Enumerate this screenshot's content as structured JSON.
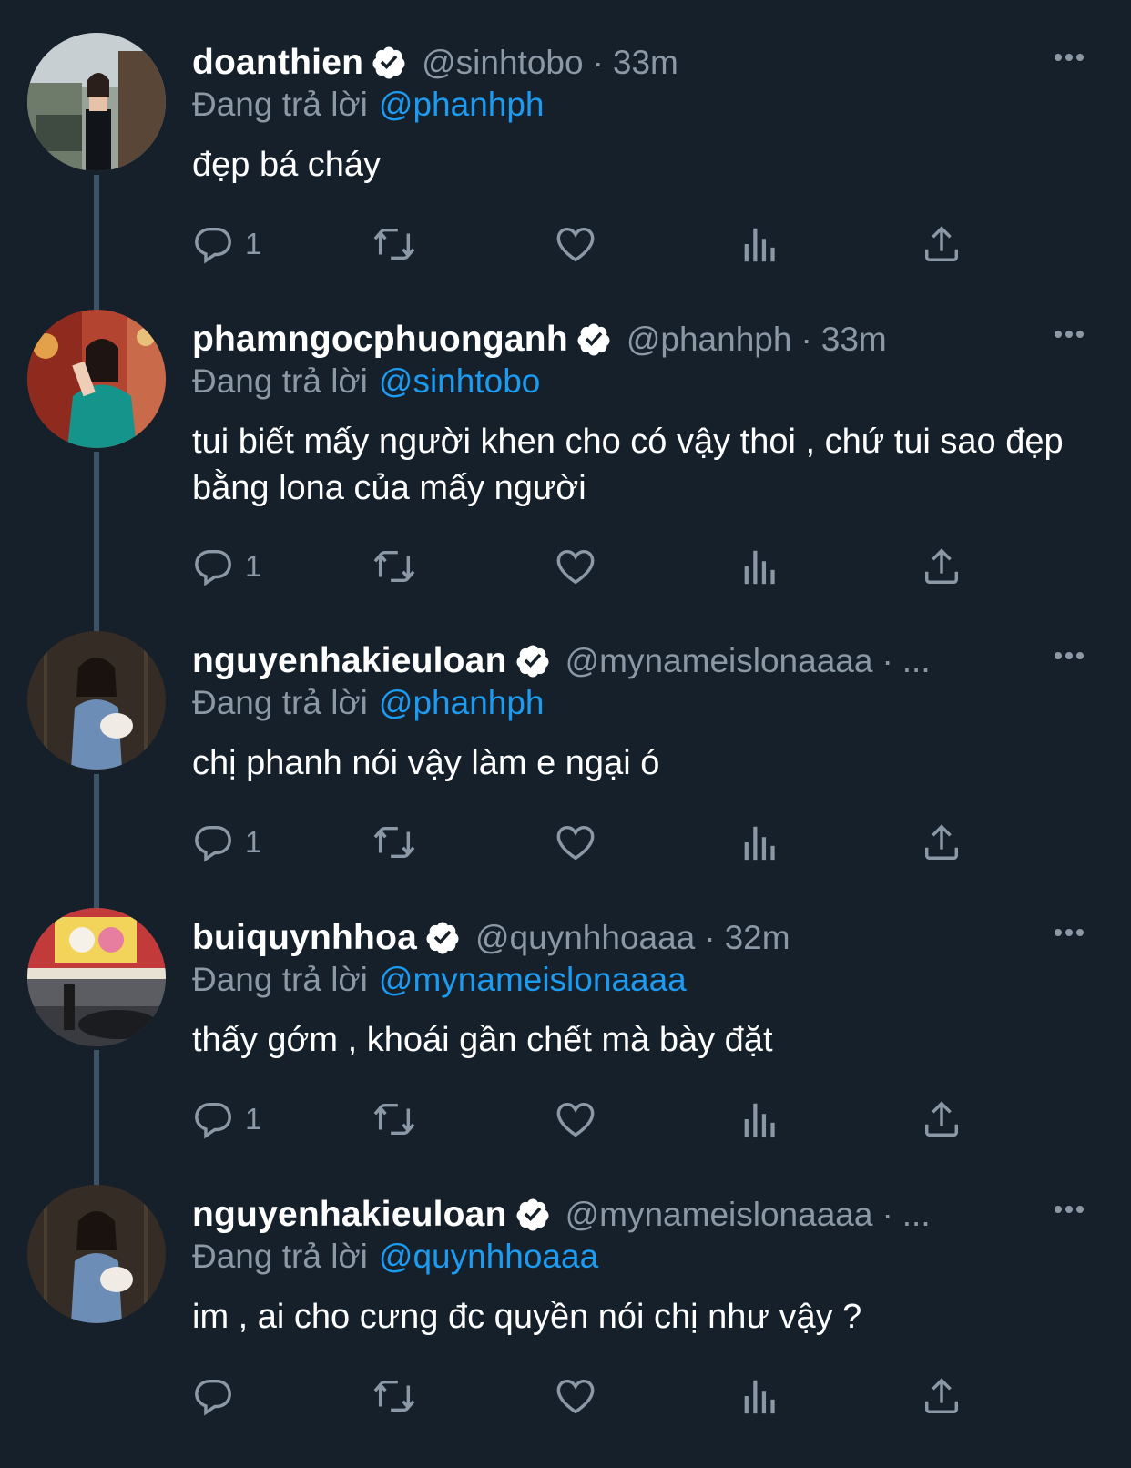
{
  "reply_prefix": "Đang trả lời",
  "colors": {
    "background": "#15202b",
    "secondary_text": "#8b98a5",
    "mention": "#1d9bf0",
    "verified": "#ffffff"
  },
  "tweets": [
    {
      "display_name": "doanthien",
      "verified": true,
      "handle": "@sinhtobo",
      "separator": "·",
      "time": "33m",
      "replying_to": "@phanhph",
      "text": "đẹp bá cháy",
      "reply_count": "1"
    },
    {
      "display_name": "phamngocphuonganh",
      "verified": true,
      "handle": "@phanhph",
      "separator": "·",
      "time": "33m",
      "replying_to": "@sinhtobo",
      "text": "tui biết mấy người khen cho có vậy thoi , chứ tui sao đẹp bằng lona của mấy người",
      "reply_count": "1"
    },
    {
      "display_name": "nguyenhakieuloan",
      "verified": true,
      "handle": "@mynameislonaaaa",
      "separator": "·",
      "time": "...",
      "replying_to": "@phanhph",
      "text": "chị phanh nói vậy làm e ngại ó",
      "reply_count": "1"
    },
    {
      "display_name": "buiquynhhoa",
      "verified": true,
      "handle": "@quynhhoaaa",
      "separator": "·",
      "time": "32m",
      "replying_to": "@mynameislonaaaa",
      "text": "thấy gớm , khoái gần chết mà bày đặt",
      "reply_count": "1"
    },
    {
      "display_name": "nguyenhakieuloan",
      "verified": true,
      "handle": "@mynameislonaaaa",
      "separator": "·",
      "time": "...",
      "replying_to": "@quynhhoaaa",
      "text": "im , ai cho cưng đc quyền nói chị như vậy ?",
      "reply_count": ""
    }
  ],
  "icons": {
    "reply": "reply-icon",
    "retweet": "retweet-icon",
    "like": "heart-icon",
    "views": "views-icon",
    "share": "share-icon",
    "more": "more-icon",
    "verified": "verified-badge-icon"
  }
}
